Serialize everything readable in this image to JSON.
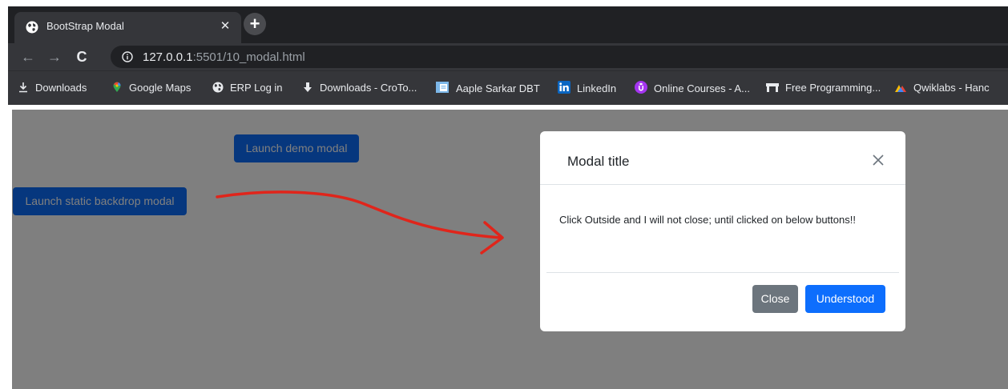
{
  "browser": {
    "tab": {
      "title": "BootStrap Modal",
      "close_glyph": "✕",
      "favicon": "globe-icon"
    },
    "new_tab_glyph": "+",
    "nav": {
      "back": "←",
      "forward": "→",
      "reload": "C"
    },
    "url": {
      "host": "127.0.0.1",
      "rest": ":5501/10_modal.html"
    },
    "bookmarks": [
      {
        "label": "Downloads",
        "icon": "download-icon"
      },
      {
        "label": "Google Maps",
        "icon": "map-pin-icon"
      },
      {
        "label": "ERP Log in",
        "icon": "globe-icon"
      },
      {
        "label": "Downloads - CroTo...",
        "icon": "download-arrow-icon"
      },
      {
        "label": "Aaple Sarkar DBT",
        "icon": "document-icon"
      },
      {
        "label": "LinkedIn",
        "icon": "linkedin-icon"
      },
      {
        "label": "Online Courses - A...",
        "icon": "udemy-icon"
      },
      {
        "label": "Free Programming...",
        "icon": "freecodecamp-icon"
      },
      {
        "label": "Qwiklabs - Hanc",
        "icon": "qwiklabs-icon"
      }
    ]
  },
  "page": {
    "demo_button": "Launch demo modal",
    "static_button": "Launch static backdrop modal"
  },
  "modal": {
    "title": "Modal title",
    "body": "Click Outside and I will not close; until clicked on below buttons!!",
    "close_button": "Close",
    "primary_button": "Understood"
  },
  "colors": {
    "primary": "#0d6efd",
    "secondary": "#6c757d",
    "annotation": "#e0251b"
  }
}
